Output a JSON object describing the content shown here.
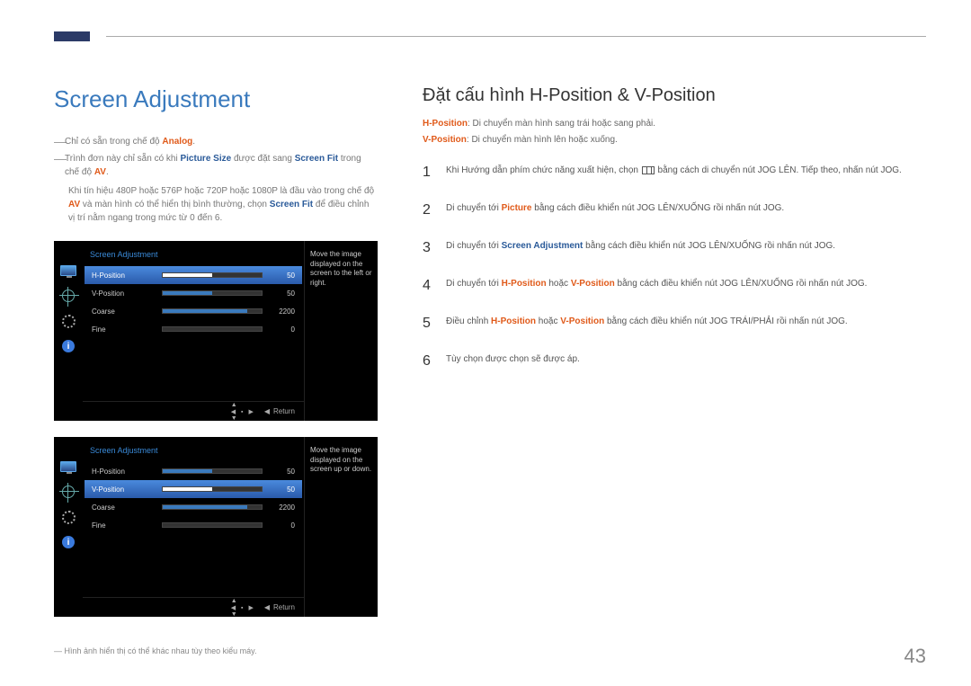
{
  "page_number": "43",
  "left": {
    "title": "Screen Adjustment",
    "note1_pre": "Chỉ có sẵn trong chế độ ",
    "note1_hl": "Analog",
    "note1_post": ".",
    "note2_pre": "Trình đơn này chỉ sẵn có khi ",
    "note2_hl1": "Picture Size",
    "note2_mid": " được đặt sang ",
    "note2_hl2": "Screen Fit",
    "note2_post": " trong chế độ ",
    "note2_hl3": "AV",
    "note2_end": ".",
    "sub_pre": "Khi tín hiệu 480P hoặc 576P hoặc 720P hoặc 1080P là đầu vào trong chế độ ",
    "sub_hl1": "AV",
    "sub_mid": " và màn hình có thể hiển thị bình thường, chọn ",
    "sub_hl2": "Screen Fit",
    "sub_post": " để điều chỉnh vị trí nằm ngang trong mức từ 0 đến 6.",
    "bottom_note": "― Hình ảnh hiển thị có thể khác nhau tùy theo kiểu máy."
  },
  "osd": {
    "title": "Screen Adjustment",
    "rows": [
      {
        "label": "H-Position",
        "value": "50",
        "fill": 50
      },
      {
        "label": "V-Position",
        "value": "50",
        "fill": 50
      },
      {
        "label": "Coarse",
        "value": "2200",
        "fill": 85
      },
      {
        "label": "Fine",
        "value": "0",
        "fill": 0
      }
    ],
    "help1": "Move the image displayed on the screen to the left or right.",
    "help2": "Move the image displayed on the screen up or down.",
    "return": "Return"
  },
  "right": {
    "title": "Đặt cấu hình H-Position & V-Position",
    "hpos_label": "H-Position",
    "hpos_desc": ": Di chuyển màn hình sang trái hoặc sang phải.",
    "vpos_label": "V-Position",
    "vpos_desc": ": Di chuyển màn hình lên hoặc xuống.",
    "steps": {
      "s1a": "Khi Hướng dẫn phím chức năng xuất hiện, chọn ",
      "s1b": " bằng cách di chuyển nút JOG LÊN. Tiếp theo, nhấn nút JOG.",
      "s2a": "Di chuyển tới ",
      "s2_hl": "Picture",
      "s2b": " bằng cách điều khiển nút JOG LÊN/XUỐNG rồi nhấn nút JOG.",
      "s3a": "Di chuyển tới ",
      "s3_hl": "Screen Adjustment",
      "s3b": " bằng cách điều khiển nút JOG LÊN/XUỐNG rồi nhấn nút JOG.",
      "s4a": "Di chuyển tới ",
      "s4_hl1": "H-Position",
      "s4_mid": " hoặc ",
      "s4_hl2": "V-Position",
      "s4b": " bằng cách điều khiển nút JOG LÊN/XUỐNG rồi nhấn nút JOG.",
      "s5a": "Điều chỉnh ",
      "s5_hl1": "H-Position",
      "s5_mid": " hoặc ",
      "s5_hl2": "V-Position",
      "s5b": " bằng cách điều khiển nút JOG TRÁI/PHẢI rồi nhấn nút JOG.",
      "s6": "Tùy chọn được chọn sẽ được áp."
    },
    "nums": {
      "n1": "1",
      "n2": "2",
      "n3": "3",
      "n4": "4",
      "n5": "5",
      "n6": "6"
    }
  }
}
